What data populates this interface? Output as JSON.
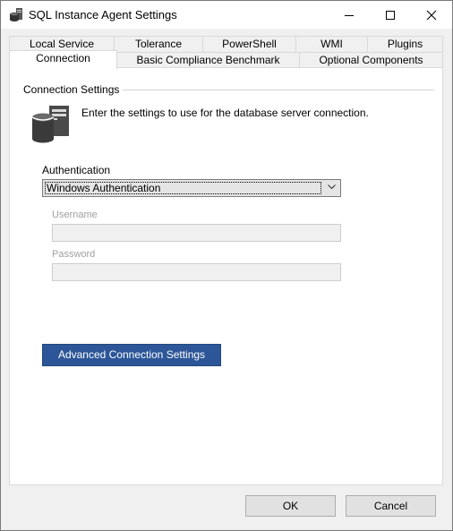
{
  "window": {
    "title": "SQL Instance Agent Settings"
  },
  "title_buttons": {
    "minimize": "minimize-icon",
    "maximize": "maximize-icon",
    "close": "close-icon"
  },
  "tabs": {
    "row1": [
      "Local Service",
      "Tolerance",
      "PowerShell",
      "WMI",
      "Plugins"
    ],
    "row2": [
      "Connection",
      "Basic Compliance Benchmark",
      "Optional Components"
    ],
    "active": "Connection"
  },
  "connection": {
    "group_label": "Connection Settings",
    "intro": "Enter the settings to use for the database server connection.",
    "icon": "database-server-icon",
    "authentication_label": "Authentication",
    "authentication_value": "Windows Authentication",
    "username_label": "Username",
    "username_value": "",
    "password_label": "Password",
    "password_value": "",
    "advanced_button": "Advanced Connection Settings"
  },
  "dialog": {
    "ok": "OK",
    "cancel": "Cancel"
  },
  "colors": {
    "accent": "#2c5697",
    "disabled_text": "#a0a0a0",
    "panel_bg": "#ffffff",
    "window_bg": "#f0f0f0"
  }
}
